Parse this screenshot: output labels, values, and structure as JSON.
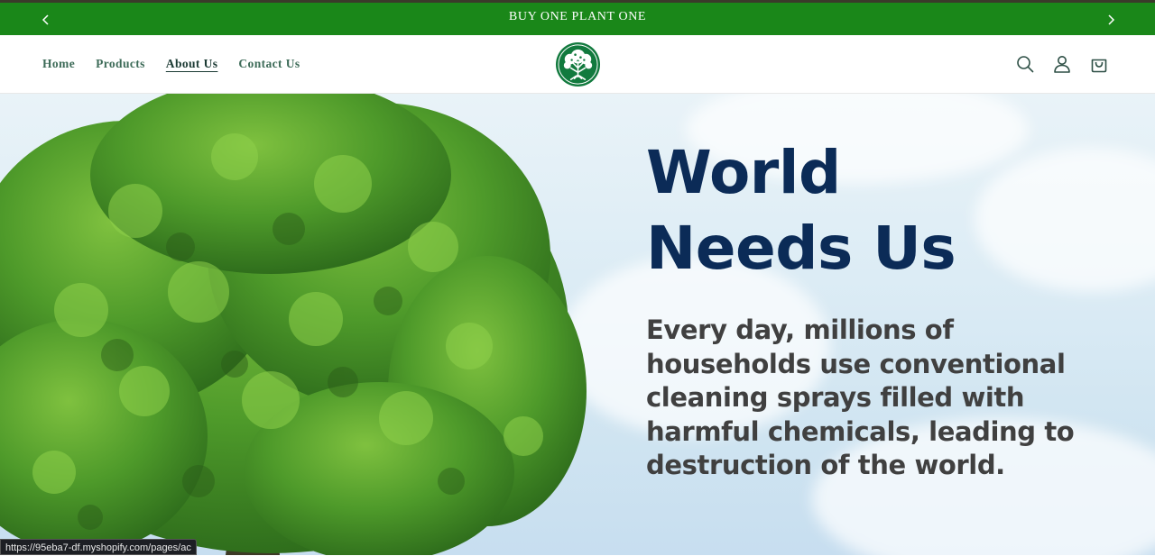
{
  "announcement": {
    "text": "BUY ONE PLANT ONE",
    "prev_icon": "chevron-left-icon",
    "next_icon": "chevron-right-icon",
    "bg_color": "#1a8719"
  },
  "header": {
    "nav": [
      {
        "label": "Home"
      },
      {
        "label": "Products"
      },
      {
        "label": "About Us",
        "active": true
      },
      {
        "label": "Contact Us"
      }
    ],
    "logo": "tree-logo-icon",
    "icons": [
      "search-icon",
      "account-icon",
      "cart-icon"
    ]
  },
  "hero": {
    "title_line1": "World",
    "title_line2": "Needs Us",
    "body": "Every day, millions of households use conventional cleaning sprays filled with harmful chemicals, leading to destruction of the world.",
    "title_color": "#0b2b57",
    "body_color": "#404040"
  },
  "status_bar": {
    "url": "https://95eba7-df.myshopify.com/pages/ac"
  }
}
